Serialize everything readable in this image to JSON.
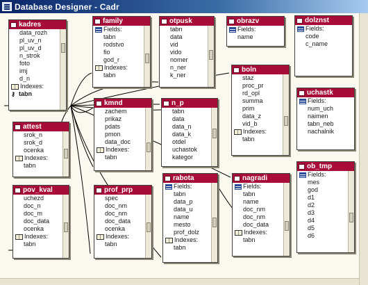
{
  "window": {
    "title": "Database Designer - Cadr"
  },
  "tables": [
    {
      "id": "kadres",
      "title": "kadres",
      "rows": [
        {
          "t": "data_rozh"
        },
        {
          "t": "pl_uv_n"
        },
        {
          "t": "pl_uv_d"
        },
        {
          "t": "n_strok"
        },
        {
          "t": "foto"
        },
        {
          "t": "imj"
        },
        {
          "t": "d_n"
        },
        {
          "t": "Indexes:",
          "kind": "book"
        },
        {
          "t": "tabn",
          "kind": "key"
        }
      ]
    },
    {
      "id": "family",
      "title": "family",
      "rows": [
        {
          "t": "Fields:",
          "kind": "grp"
        },
        {
          "t": "tabn"
        },
        {
          "t": "rodstvo"
        },
        {
          "t": "fio"
        },
        {
          "t": "god_r"
        },
        {
          "t": "Indexes:",
          "kind": "book"
        },
        {
          "t": "tabn"
        }
      ]
    },
    {
      "id": "otpusk",
      "title": "otpusk",
      "rows": [
        {
          "t": "tabn"
        },
        {
          "t": "data"
        },
        {
          "t": "vid"
        },
        {
          "t": "vido"
        },
        {
          "t": "nomer"
        },
        {
          "t": "n_ner"
        },
        {
          "t": "k_ner"
        }
      ]
    },
    {
      "id": "obrazv",
      "title": "obrazv",
      "rows": [
        {
          "t": "Fields:",
          "kind": "grp"
        },
        {
          "t": "name"
        }
      ]
    },
    {
      "id": "dolznst",
      "title": "dolznst",
      "rows": [
        {
          "t": "Fields:",
          "kind": "grp"
        },
        {
          "t": "code"
        },
        {
          "t": "c_name"
        }
      ]
    },
    {
      "id": "boln",
      "title": "boln",
      "rows": [
        {
          "t": "staz"
        },
        {
          "t": "proc_pr"
        },
        {
          "t": "rd_opl"
        },
        {
          "t": "summa"
        },
        {
          "t": "prim"
        },
        {
          "t": "data_z"
        },
        {
          "t": "vid_b"
        },
        {
          "t": "Indexes:",
          "kind": "book"
        },
        {
          "t": "tabn"
        }
      ]
    },
    {
      "id": "uchastk",
      "title": "uchastk",
      "rows": [
        {
          "t": "Fields:",
          "kind": "grp"
        },
        {
          "t": "num_uch"
        },
        {
          "t": "naimen"
        },
        {
          "t": "tabn_neb"
        },
        {
          "t": "nachalnik"
        }
      ]
    },
    {
      "id": "attest",
      "title": "attest",
      "rows": [
        {
          "t": "srok_n"
        },
        {
          "t": "srok_d"
        },
        {
          "t": "ocenka"
        },
        {
          "t": "Indexes:",
          "kind": "book"
        },
        {
          "t": "tabn"
        }
      ]
    },
    {
      "id": "kmnd",
      "title": "kmnd",
      "rows": [
        {
          "t": "zachem"
        },
        {
          "t": "prikaz"
        },
        {
          "t": "pdats"
        },
        {
          "t": "pmon"
        },
        {
          "t": "data_doc"
        },
        {
          "t": "Indexes:",
          "kind": "book"
        },
        {
          "t": "tabn"
        }
      ]
    },
    {
      "id": "n_p",
      "title": "n_p",
      "rows": [
        {
          "t": "tabn"
        },
        {
          "t": "data"
        },
        {
          "t": "data_n"
        },
        {
          "t": "data_k"
        },
        {
          "t": "otdel"
        },
        {
          "t": "uchastok"
        },
        {
          "t": "kategor"
        }
      ]
    },
    {
      "id": "ob_tmp",
      "title": "ob_tmp",
      "rows": [
        {
          "t": "Fields:",
          "kind": "grp"
        },
        {
          "t": "mes"
        },
        {
          "t": "god"
        },
        {
          "t": "d1"
        },
        {
          "t": "d2"
        },
        {
          "t": "d3"
        },
        {
          "t": "d4"
        },
        {
          "t": "d5"
        },
        {
          "t": "d6"
        }
      ]
    },
    {
      "id": "pov_kval",
      "title": "pov_kval",
      "rows": [
        {
          "t": "uchezd"
        },
        {
          "t": "doc_n"
        },
        {
          "t": "doc_m"
        },
        {
          "t": "doc_data"
        },
        {
          "t": "ocenka"
        },
        {
          "t": "Indexes:",
          "kind": "book"
        },
        {
          "t": "tabn"
        }
      ]
    },
    {
      "id": "prof_prp",
      "title": "prof_prp",
      "rows": [
        {
          "t": "spec"
        },
        {
          "t": "doc_nm"
        },
        {
          "t": "doc_nm"
        },
        {
          "t": "doc_data"
        },
        {
          "t": "ocenka"
        },
        {
          "t": "Indexes:",
          "kind": "book"
        },
        {
          "t": "tabn"
        }
      ]
    },
    {
      "id": "rabota",
      "title": "rabota",
      "rows": [
        {
          "t": "Fields:",
          "kind": "grp"
        },
        {
          "t": "tabn"
        },
        {
          "t": "data_p"
        },
        {
          "t": "data_u"
        },
        {
          "t": "name"
        },
        {
          "t": "mesto"
        },
        {
          "t": "prof_dolz"
        },
        {
          "t": "Indexes:",
          "kind": "book"
        },
        {
          "t": "tabn"
        }
      ]
    },
    {
      "id": "nagradi",
      "title": "nagradi",
      "rows": [
        {
          "t": "Fields:",
          "kind": "grp"
        },
        {
          "t": "tabn"
        },
        {
          "t": "name"
        },
        {
          "t": "doc_nm"
        },
        {
          "t": "doc_nm"
        },
        {
          "t": "doc_data"
        },
        {
          "t": "Indexes:",
          "kind": "book"
        },
        {
          "t": "tabn"
        }
      ]
    }
  ]
}
